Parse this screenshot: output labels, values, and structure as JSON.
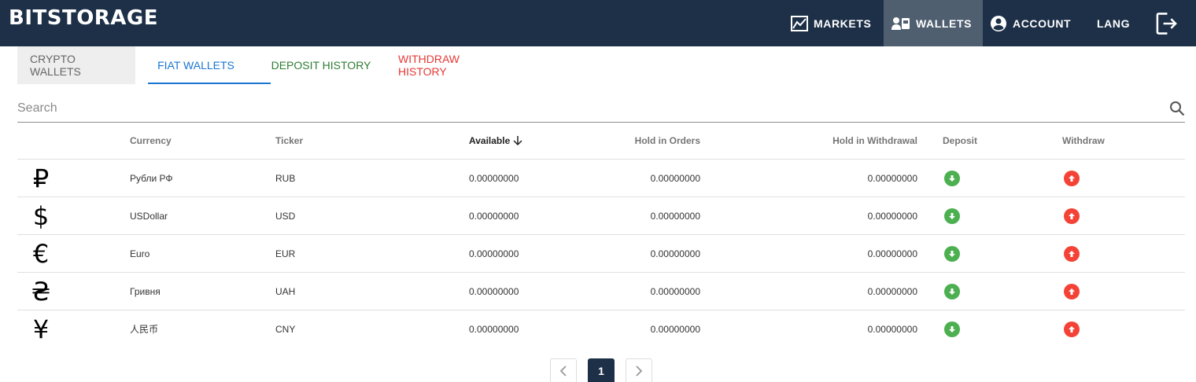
{
  "header": {
    "logo": "BITSTORAGE",
    "nav": [
      {
        "label": "MARKETS",
        "icon": "chart-line-icon"
      },
      {
        "label": "WALLETS",
        "icon": "wallet-icon"
      },
      {
        "label": "ACCOUNT",
        "icon": "account-circle-icon"
      },
      {
        "label": "LANG"
      }
    ],
    "logout_icon": "logout-icon"
  },
  "tabs": [
    {
      "label": "CRYPTO WALLETS"
    },
    {
      "label": "FIAT WALLETS"
    },
    {
      "label": "DEPOSIT HISTORY"
    },
    {
      "label": "WITHDRAW HISTORY"
    }
  ],
  "search": {
    "placeholder": "Search",
    "value": ""
  },
  "table": {
    "columns": {
      "currency": "Currency",
      "ticker": "Ticker",
      "available": "Available",
      "hold_orders": "Hold in Orders",
      "hold_withdrawal": "Hold in Withdrawal",
      "deposit": "Deposit",
      "withdraw": "Withdraw"
    },
    "rows": [
      {
        "symbol": "₽",
        "currency": "Рубли РФ",
        "ticker": "RUB",
        "available": "0.00000000",
        "hold_orders": "0.00000000",
        "hold_withdrawal": "0.00000000"
      },
      {
        "symbol": "$",
        "currency": "USDollar",
        "ticker": "USD",
        "available": "0.00000000",
        "hold_orders": "0.00000000",
        "hold_withdrawal": "0.00000000"
      },
      {
        "symbol": "€",
        "currency": "Euro",
        "ticker": "EUR",
        "available": "0.00000000",
        "hold_orders": "0.00000000",
        "hold_withdrawal": "0.00000000"
      },
      {
        "symbol": "₴",
        "currency": "Гривня",
        "ticker": "UAH",
        "available": "0.00000000",
        "hold_orders": "0.00000000",
        "hold_withdrawal": "0.00000000"
      },
      {
        "symbol": "¥",
        "currency": "人民币",
        "ticker": "CNY",
        "available": "0.00000000",
        "hold_orders": "0.00000000",
        "hold_withdrawal": "0.00000000"
      }
    ]
  },
  "pagination": {
    "current": "1"
  },
  "colors": {
    "topbar": "#1d3048",
    "active_nav": "#4f5f70",
    "fiat_tab": "#1976d2",
    "deposit_tab": "#2e7d32",
    "withdraw_tab": "#e53935",
    "deposit_btn": "#4caf50",
    "withdraw_btn": "#f44336"
  }
}
